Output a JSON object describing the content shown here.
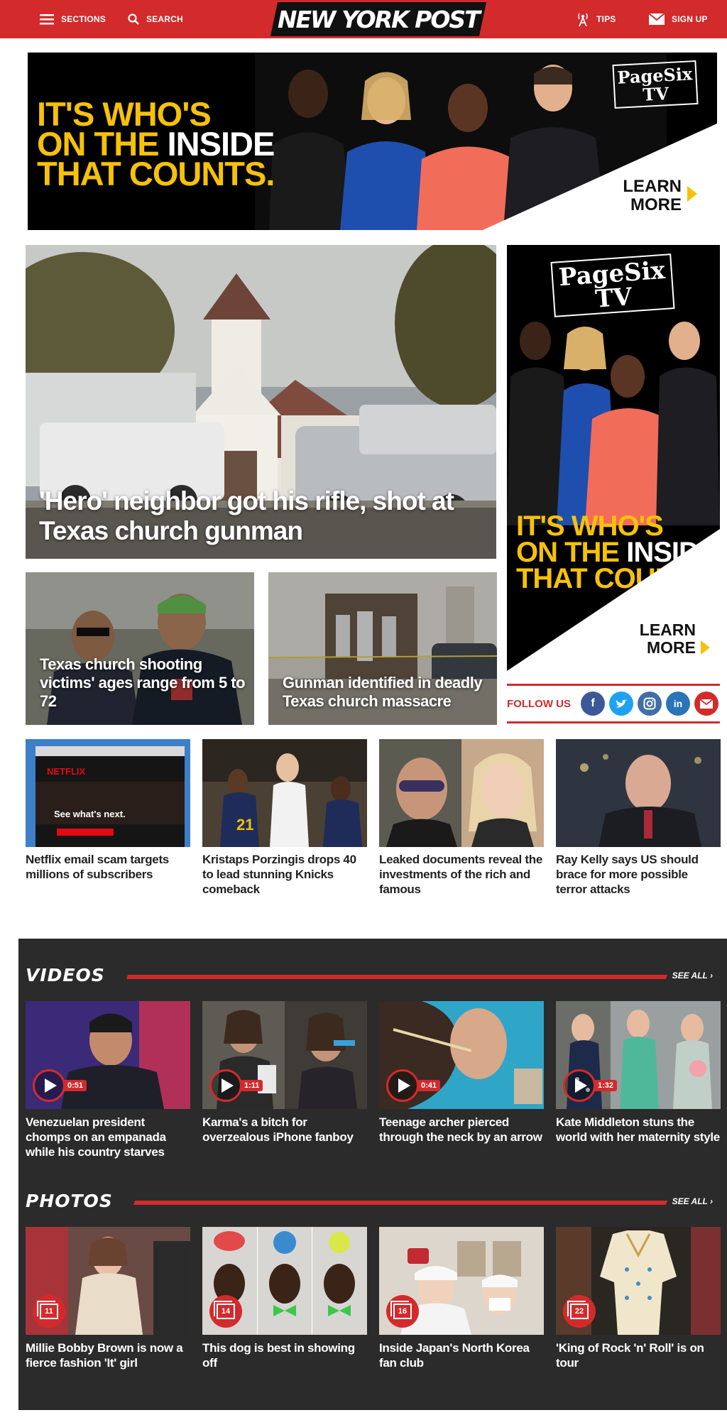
{
  "header": {
    "sections_label": "SECTIONS",
    "search_label": "SEARCH",
    "logo_text": "NEW YORK POST",
    "tips_label": "TIPS",
    "signup_label": "SIGN UP",
    "brand_color": "#d32a2c"
  },
  "banner_ad": {
    "line1": "IT'S WHO'S",
    "line2_yellow": "ON THE",
    "line2_white": "INSIDE",
    "line3": "THAT COUNTS.",
    "brand_line1": "PageSix",
    "brand_line2": "TV",
    "learn_line1": "LEARN",
    "learn_line2": "MORE",
    "accent_color": "#f6c10a"
  },
  "hero": {
    "headline": "'Hero' neighbor got his rifle, shot at Texas church gunman"
  },
  "secondary_stories": [
    {
      "headline": "Texas church shooting victims' ages range from 5 to 72"
    },
    {
      "headline": "Gunman identified in deadly Texas church massacre"
    }
  ],
  "side_ad": {
    "brand_line1": "PageSix",
    "brand_line2": "TV",
    "line1": "IT'S WHO'S",
    "line2_yellow": "ON THE",
    "line2_white": "INSIDE",
    "line3": "THAT COUNTS.",
    "learn_line1": "LEARN",
    "learn_line2": "MORE"
  },
  "follow": {
    "label": "FOLLOW US",
    "networks": [
      {
        "icon": "facebook-icon",
        "glyph": "f",
        "color": "#3b5998"
      },
      {
        "icon": "twitter-icon",
        "glyph": "t",
        "color": "#1da1f2"
      },
      {
        "icon": "instagram-icon",
        "glyph": "◎",
        "color": "#3f6fa6"
      },
      {
        "icon": "linkedin-icon",
        "glyph": "in",
        "color": "#2a74b8"
      },
      {
        "icon": "email-icon",
        "glyph": "✉",
        "color": "#d32a2c"
      }
    ]
  },
  "stories": [
    {
      "title": "Netflix email scam targets millions of subscribers"
    },
    {
      "title": "Kristaps Porzingis drops 40 to lead stunning Knicks comeback"
    },
    {
      "title": "Leaked documents reveal the investments of the rich and famous"
    },
    {
      "title": "Ray Kelly says US should brace for more possible terror attacks"
    }
  ],
  "thumb_text": {
    "netflix_logo": "NETFLIX",
    "netflix_tagline": "See what's next.",
    "jersey_number": "21"
  },
  "videos": {
    "section_title": "VIDEOS",
    "see_all": "SEE ALL",
    "items": [
      {
        "title": "Venezuelan president chomps on an empanada while his country starves",
        "duration": "0:51"
      },
      {
        "title": "Karma's a bitch for overzealous iPhone fanboy",
        "duration": "1:11"
      },
      {
        "title": "Teenage archer pierced through the neck by an arrow",
        "duration": "0:41"
      },
      {
        "title": "Kate Middleton stuns the world with her maternity style",
        "duration": "1:32"
      }
    ]
  },
  "photos": {
    "section_title": "PHOTOS",
    "see_all": "SEE ALL",
    "items": [
      {
        "title": "Millie Bobby Brown is now a fierce fashion 'It' girl",
        "count": "11"
      },
      {
        "title": "This dog is best in showing off",
        "count": "14"
      },
      {
        "title": "Inside Japan's North Korea fan club",
        "count": "16"
      },
      {
        "title": "'King of Rock 'n' Roll' is on tour",
        "count": "22"
      }
    ]
  }
}
